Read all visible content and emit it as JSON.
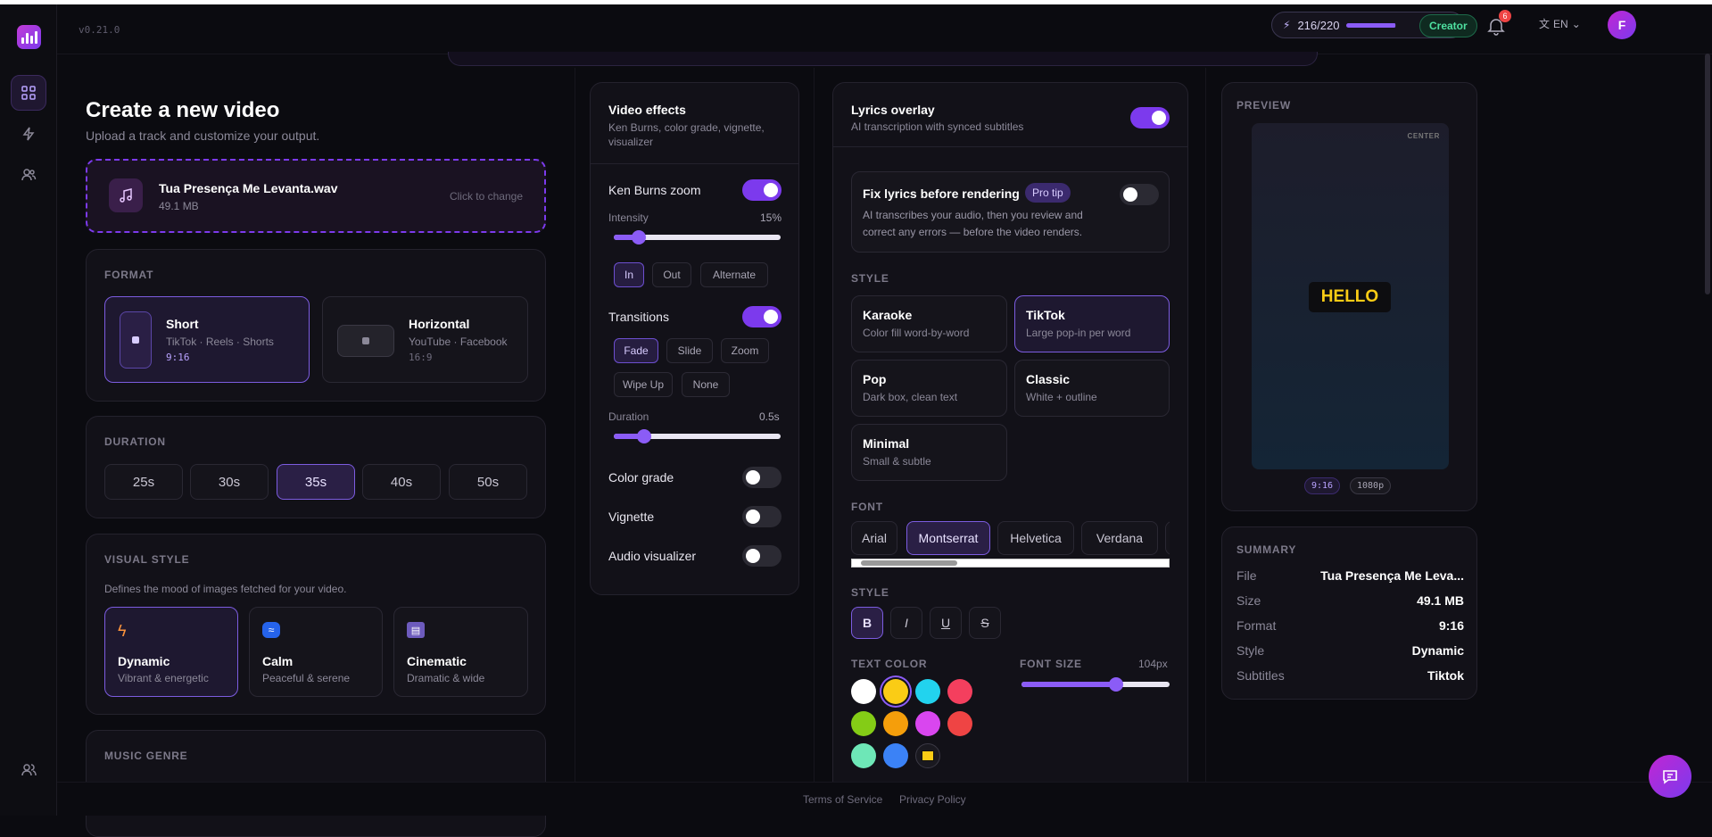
{
  "app": {
    "version": "v0.21.0"
  },
  "topbar": {
    "credits": "216/220",
    "credits_ratio": 0.98,
    "plan": "Creator",
    "notifications": "6",
    "language": "EN",
    "avatar_initial": "F"
  },
  "page": {
    "title": "Create a new video",
    "subtitle": "Upload a track and customize your output."
  },
  "upload": {
    "filename": "Tua Presença Me Levanta.wav",
    "size": "49.1 MB",
    "change_label": "Click to change"
  },
  "format": {
    "label": "FORMAT",
    "options": [
      {
        "name": "Short",
        "platforms": "TikTok · Reels · Shorts",
        "ratio": "9:16"
      },
      {
        "name": "Horizontal",
        "platforms": "YouTube · Facebook",
        "ratio": "16:9"
      }
    ]
  },
  "duration": {
    "label": "DURATION",
    "options": [
      "25s",
      "30s",
      "35s",
      "40s",
      "50s"
    ],
    "selected": "35s"
  },
  "visual_style": {
    "label": "VISUAL STYLE",
    "description": "Defines the mood of images fetched for your video.",
    "options": [
      {
        "name": "Dynamic",
        "desc": "Vibrant & energetic"
      },
      {
        "name": "Calm",
        "desc": "Peaceful & serene"
      },
      {
        "name": "Cinematic",
        "desc": "Dramatic & wide"
      }
    ]
  },
  "music_genre": {
    "label": "MUSIC GENRE"
  },
  "effects": {
    "title": "Video effects",
    "desc": "Ken Burns, color grade, vignette, visualizer",
    "ken_burns": "Ken Burns zoom",
    "intensity_label": "Intensity",
    "intensity_value": "15%",
    "intensity_ratio": 0.15,
    "zoom_dirs": [
      "In",
      "Out",
      "Alternate"
    ],
    "transitions": "Transitions",
    "transition_types": [
      "Fade",
      "Slide",
      "Zoom",
      "Wipe Up",
      "None"
    ],
    "duration_label": "Duration",
    "duration_value": "0.5s",
    "duration_ratio": 0.18,
    "color_grade": "Color grade",
    "vignette": "Vignette",
    "audio_visualizer": "Audio visualizer"
  },
  "lyrics": {
    "title": "Lyrics overlay",
    "desc": "AI transcription with synced subtitles",
    "fix_title": "Fix lyrics before rendering",
    "pro_tip": "Pro tip",
    "fix_desc_1": "AI transcribes your audio, then you review and",
    "fix_desc_2": "correct any errors — before the video renders.",
    "style_label": "STYLE",
    "styles": [
      {
        "name": "Karaoke",
        "desc": "Color fill word-by-word"
      },
      {
        "name": "TikTok",
        "desc": "Large pop-in per word"
      },
      {
        "name": "Pop",
        "desc": "Dark box, clean text"
      },
      {
        "name": "Classic",
        "desc": "White + outline"
      },
      {
        "name": "Minimal",
        "desc": "Small & subtle"
      }
    ],
    "font_label": "FONT",
    "fonts": [
      "Arial",
      "Montserrat",
      "Helvetica",
      "Verdana"
    ],
    "text_style_label": "STYLE",
    "text_styles": [
      "B",
      "I",
      "U",
      "S"
    ],
    "text_color_label": "TEXT COLOR",
    "colors": [
      "#ffffff",
      "#facc15",
      "#22d3ee",
      "#f43f5e",
      "#84cc16",
      "#f59e0b",
      "#d946ef",
      "#ef4444",
      "#6ee7b7",
      "#3b82f6"
    ],
    "font_size_label": "FONT SIZE",
    "font_size_value": "104px",
    "font_size_ratio": 0.64
  },
  "preview": {
    "label": "PREVIEW",
    "position": "CENTER",
    "sample": "HELLO",
    "ratio": "9:16",
    "resolution": "1080p"
  },
  "summary": {
    "label": "SUMMARY",
    "rows": [
      {
        "k": "File",
        "v": "Tua Presença Me Leva..."
      },
      {
        "k": "Size",
        "v": "49.1 MB"
      },
      {
        "k": "Format",
        "v": "9:16"
      },
      {
        "k": "Style",
        "v": "Dynamic"
      },
      {
        "k": "Subtitles",
        "v": "Tiktok"
      }
    ]
  },
  "footer": {
    "terms": "Terms of Service",
    "privacy": "Privacy Policy"
  }
}
